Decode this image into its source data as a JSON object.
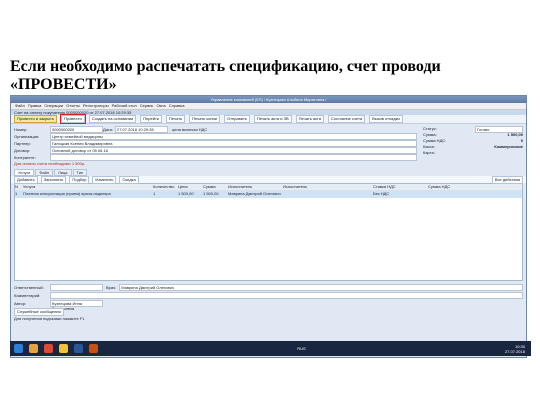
{
  "caption": "Если необходимо распечатать спецификацию, счет проводи «ПРОВЕСТИ»",
  "window": {
    "title": "Управление компанией (КП) / Кузнецова Альбина Миратовна /",
    "menu": [
      "Файл",
      "Правка",
      "Операции",
      "Отчеты",
      "Регистраторы",
      "Рабочий стол",
      "Сервис",
      "Окна",
      "Справка"
    ],
    "doc_title": "Счет на оплату покупателю 0000000020 от 27.07.2018 10:29:35"
  },
  "toolbar": {
    "post_close": "Провести и закрыть",
    "post": "Провести",
    "create_from": "Создать на основании",
    "go": "Перейти",
    "print": "Печать",
    "print_copy": "Печать копии",
    "edit": "Отправить",
    "print_close": "Печать акта и ЗВ",
    "print_more": "Печать акта",
    "state": "Состояние счета",
    "extra": "Вызов отладки"
  },
  "form": {
    "number_label": "Номер:",
    "number_value": "0000000020",
    "date_label": "Дата:",
    "date_value": "27.07.2018 10:29:35",
    "vat_label": "цена включая НДС",
    "org_label": "Организация:",
    "org_value": "Центр семейной медицины",
    "counterparty_label": "Партнер:",
    "counterparty_value": "Галицкая Ксения Владимировна",
    "contract_label": "Договор:",
    "contract_value": "Основной договор от 05.06.18",
    "agreement_label": "Контрагент:",
    "agreement_value": "",
    "status_label": "Статус:",
    "status_value": "Готово",
    "sum_label": "Сумма:",
    "sum_value": "1 500,00",
    "vat_sum_label": "Сумма НДС:",
    "vat_sum_value": "0",
    "payment_label": "Касса:",
    "payment_value": "Коммерческие",
    "card_label": "Карта:",
    "card_value": ""
  },
  "alert_link": "Для оплаты счета необходимо 1 500р.",
  "tabs": [
    "Услуги",
    "Файл",
    "Лица",
    "Тип"
  ],
  "grid_toolbar": {
    "add": "Добавить",
    "fill": "Заполнить",
    "select": "Подбор",
    "prices": "Изменить",
    "discount": "Скидка",
    "all_actions": "Все действия"
  },
  "grid": {
    "headers": [
      "N",
      "Услуга",
      "Количество",
      "Цена",
      "Сумма",
      "Исполнитель",
      "Исполнитель",
      "Ставка НДС",
      "Сумма НДС"
    ],
    "rows": [
      [
        "1",
        "Платная консультация (прием) врача-педиатра",
        "1",
        "1 500,00",
        "1 500,00",
        "Маврина Дмитрий Олегович",
        "",
        "Без НДС",
        ""
      ]
    ]
  },
  "footer": {
    "responsible_label": "Ответственный:",
    "responsible_value": "",
    "doctor_label": "Врач:",
    "doctor_value": "Маврина Дмитрий Олегович",
    "comment_label": "Комментарий:",
    "comment_value": "",
    "author_label": "Автор:",
    "author_value": "Кузнецова Инна Витальевна",
    "btn_messages": "Служебные сообщения",
    "status_line": "Для получения подсказки нажмите F1"
  },
  "taskbar": {
    "time": "10:30",
    "date": "27.07.2018",
    "lang": "RUS"
  },
  "colors": {
    "post_highlight": "#d9201e",
    "window_bg": "#dfe8f3",
    "selected_row": "#cfe3f7"
  }
}
